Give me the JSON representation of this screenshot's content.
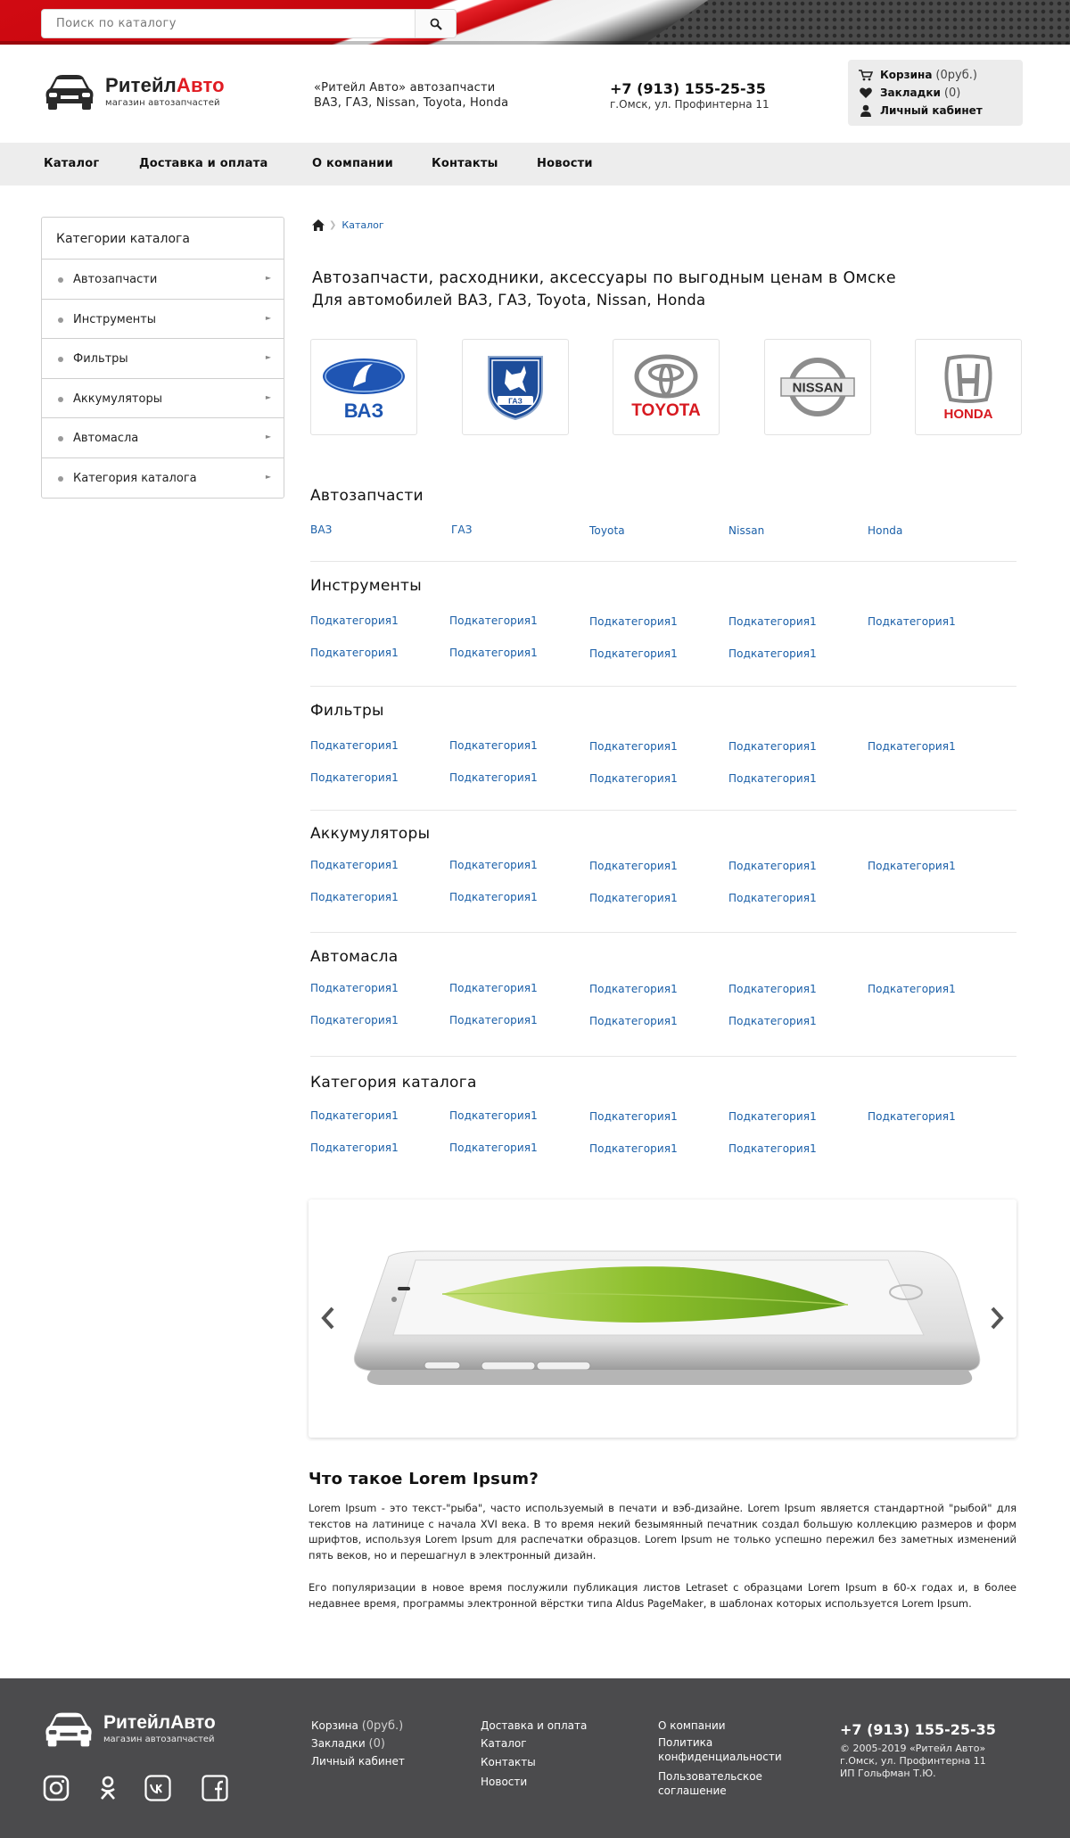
{
  "search": {
    "placeholder": "Поиск по каталогу"
  },
  "header": {
    "logo_dark": "Ритейл",
    "logo_red": "Авто",
    "logo_sub": "магазин автозапчастей",
    "desc_line1": "«Ритейл Авто» автозапчасти",
    "desc_line2": "ВАЗ, ГАЗ, Nissan, Toyota, Honda",
    "phone": "+7 (913) 155-25-35",
    "address": "г.Омск, ул. Профинтерна 11",
    "cart_label": "Корзина",
    "cart_count": "(0руб.)",
    "bookmarks_label": "Закладки",
    "bookmarks_count": "(0)",
    "account_label": "Личный кабинет"
  },
  "nav": [
    "Каталог",
    "Доставка и оплата",
    "О компании",
    "Контакты",
    "Новости"
  ],
  "sidebar": {
    "title": "Категории каталога",
    "items": [
      "Автозапчасти",
      "Инструменты",
      "Фильтры",
      "Аккумуляторы",
      "Автомасла",
      "Категория каталога"
    ]
  },
  "breadcrumb": {
    "current": "Каталог"
  },
  "main": {
    "heading": "Автозапчасти, расходники, аксессуары по выгодным ценам в Омске",
    "subheading": "Для автомобилей ВАЗ, ГАЗ, Toyota, Nissan, Honda",
    "brands": [
      "ВАЗ",
      "ГАЗ",
      "TOYOTA",
      "NISSAN",
      "HONDA"
    ]
  },
  "sections": [
    {
      "title": "Автозапчасти",
      "links": [
        "ВАЗ",
        "ГАЗ",
        "Toyota",
        "Nissan",
        "Honda"
      ]
    },
    {
      "title": "Инструменты",
      "links": [
        "Подкатегория1",
        "Подкатегория1",
        "Подкатегория1",
        "Подкатегория1",
        "Подкатегория1",
        "Подкатегория1",
        "Подкатегория1",
        "Подкатегория1",
        "Подкатегория1"
      ]
    },
    {
      "title": "Фильтры",
      "links": [
        "Подкатегория1",
        "Подкатегория1",
        "Подкатегория1",
        "Подкатегория1",
        "Подкатегория1",
        "Подкатегория1",
        "Подкатегория1",
        "Подкатегория1",
        "Подкатегория1"
      ]
    },
    {
      "title": "Аккумуляторы",
      "links": [
        "Подкатегория1",
        "Подкатегория1",
        "Подкатегория1",
        "Подкатегория1",
        "Подкатегория1",
        "Подкатегория1",
        "Подкатегория1",
        "Подкатегория1",
        "Подкатегория1"
      ]
    },
    {
      "title": "Автомасла",
      "links": [
        "Подкатегория1",
        "Подкатегория1",
        "Подкатегория1",
        "Подкатегория1",
        "Подкатегория1",
        "Подкатегория1",
        "Подкатегория1",
        "Подкатегория1",
        "Подкатегория1"
      ]
    },
    {
      "title": "Категория каталога",
      "links": [
        "Подкатегория1",
        "Подкатегория1",
        "Подкатегория1",
        "Подкатегория1",
        "Подкатегория1",
        "Подкатегория1",
        "Подкатегория1",
        "Подкатегория1",
        "Подкатегория1"
      ]
    }
  ],
  "about": {
    "title": "Что такое Lorem Ipsum?",
    "p1": "Lorem Ipsum - это текст-\"рыба\", часто используемый в печати и вэб-дизайне. Lorem Ipsum является стандартной \"рыбой\" для текстов на латинице с начала XVI века. В то время некий безымянный печатник создал большую коллекцию размеров и форм шрифтов, используя Lorem Ipsum для распечатки образцов. Lorem Ipsum не только успешно пережил без заметных изменений пять веков, но и перешагнул в электронный дизайн.",
    "p2": "Его популяризации в новое время послужили публикация листов Letraset с образцами Lorem Ipsum в 60-х годах и, в более недавнее время, программы электронной вёрстки типа Aldus PageMaker, в шаблонах которых используется Lorem Ipsum."
  },
  "footer": {
    "logo": "РитейлАвто",
    "logo_sub": "магазин автозапчастей",
    "cart_label": "Корзина",
    "cart_count": "(0руб.)",
    "bookmarks_label": "Закладки",
    "bookmarks_count": "(0)",
    "account_label": "Личный кабинет",
    "col2": [
      "Доставка и оплата",
      "Каталог",
      "Контакты",
      "Новости"
    ],
    "col3": [
      "О компании",
      "Политика",
      "конфиденциальности",
      "Пользовательское",
      "соглашение"
    ],
    "phone": "+7 (913) 155-25-35",
    "copyright": "© 2005-2019 «Ритейл Авто»",
    "address": "г.Омск, ул. Профинтерна 11",
    "owner": "ИП Гольфман Т.Ю.",
    "social_icons": [
      "instagram-icon",
      "odnoklassniki-icon",
      "vk-icon",
      "facebook-icon"
    ]
  },
  "colors": {
    "accent_red": "#e01b22",
    "link_blue": "#1a5fa8",
    "footer_bg": "#4b4b4d",
    "nav_bg": "#ededed"
  }
}
